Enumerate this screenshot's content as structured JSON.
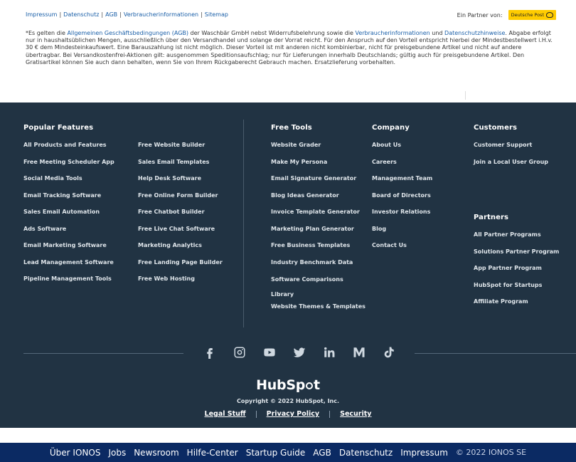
{
  "legal": {
    "links": [
      "Impressum",
      "Datenschutz",
      "AGB",
      "Verbraucherinformationen",
      "Sitemap"
    ],
    "partner_label": "Ein Partner von:",
    "partner_badge": "Deutsche Post",
    "text_parts": {
      "p1": "*Es gelten die ",
      "agb_link": "Allgemeinen Geschäftsbedingungen (AGB)",
      "p2": " der Waschbär GmbH nebst Widerrufsbelehrung sowie die ",
      "vi_link": "Verbraucherinformationen",
      "p3": " und ",
      "ds_link": "Datenschutzhinweise",
      "p4": ". Abgabe erfolgt nur in haushaltsüblichen Mengen, ausschließlich über den Versandhandel und solange der Vorrat reicht. Für den Anspruch auf den Vorteil entspricht hierbei der Mindestbestellwert i.H.v. 30 € dem Mindesteinkaufswert. Eine Barauszahlung ist nicht möglich. Dieser Vorteil ist mit anderen nicht kombinierbar, nicht für preisgebundene Artikel und nicht auf andere übertragbar. Bei Versandkostenfrei-Aktionen gilt: ausgenommen Speditionsaufschlag; nur für Lieferungen innerhalb Deutschlands; gültig auch für preisgebundene Artikel. Den Gratisartikel können Sie auch dann behalten, wenn Sie von Ihrem Rückgaberecht Gebrauch machen. Ersatzlieferung vorbehalten."
    }
  },
  "footer": {
    "popular": {
      "title": "Popular Features",
      "col1": [
        "All Products and Features",
        "Free Meeting Scheduler App",
        "Social Media Tools",
        "Email Tracking Software",
        "Sales Email Automation",
        "Ads Software",
        "Email Marketing Software",
        "Lead Management Software",
        "Pipeline Management Tools"
      ],
      "col2": [
        "Free Website Builder",
        "Sales Email Templates",
        "Help Desk Software",
        "Free Online Form Builder",
        "Free Chatbot Builder",
        "Free Live Chat Software",
        "Marketing Analytics",
        "Free Landing Page Builder",
        "Free Web Hosting"
      ]
    },
    "free_tools": {
      "title": "Free Tools",
      "items": [
        "Website Grader",
        "Make My Persona",
        "Email Signature Generator",
        "Blog Ideas Generator",
        "Invoice Template Generator",
        "Marketing Plan Generator",
        "Free Business Templates",
        "Industry Benchmark Data",
        "Software Comparisons Library",
        "Website Themes & Templates"
      ]
    },
    "company": {
      "title": "Company",
      "items": [
        "About Us",
        "Careers",
        "Management Team",
        "Board of Directors",
        "Investor Relations",
        "Blog",
        "Contact Us"
      ]
    },
    "customers": {
      "title": "Customers",
      "items": [
        "Customer Support",
        "Join a Local User Group"
      ]
    },
    "partners": {
      "title": "Partners",
      "items": [
        "All Partner Programs",
        "Solutions Partner Program",
        "App Partner Program",
        "HubSpot for Startups",
        "Affiliate Program"
      ]
    },
    "social": [
      "facebook-icon",
      "instagram-icon",
      "youtube-icon",
      "twitter-icon",
      "linkedin-icon",
      "medium-icon",
      "tiktok-icon"
    ],
    "logo_text_a": "Hub",
    "logo_text_b": "S",
    "logo_text_c": "p",
    "logo_text_d": "t",
    "copyright": "Copyright © 2022 HubSpot, Inc.",
    "policy": [
      "Legal Stuff",
      "Privacy Policy",
      "Security"
    ]
  },
  "ionos": {
    "links": [
      "Über IONOS",
      "Jobs",
      "Newsroom",
      "Hilfe-Center",
      "Startup Guide",
      "AGB",
      "Datenschutz",
      "Impressum"
    ],
    "copyright": "© 2022 IONOS SE"
  },
  "colors": {
    "footer_bg": "#213343",
    "ionos_bg": "#0b2a63",
    "link_blue": "#1a5fa8",
    "post_yellow": "#ffcc00"
  }
}
